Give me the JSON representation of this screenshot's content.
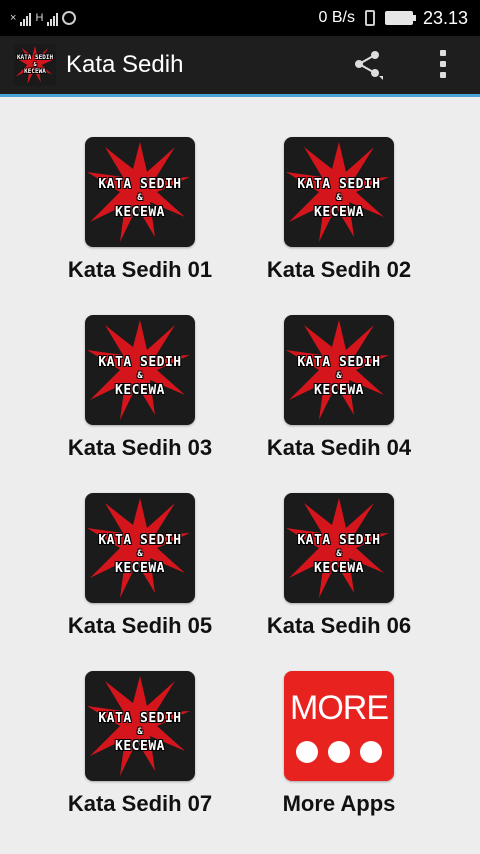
{
  "status_bar": {
    "net_type": "H",
    "data_speed": "0 B/s",
    "time": "23.13"
  },
  "action_bar": {
    "title": "Kata Sedih",
    "icon_text_line1": "KATA SEDIH",
    "icon_text_line2": "&",
    "icon_text_line3": "KECEWA"
  },
  "thumb_text": {
    "line1": "KATA SEDIH",
    "line2": "&",
    "line3": "KECEWA"
  },
  "items": [
    {
      "label": "Kata Sedih 01"
    },
    {
      "label": "Kata Sedih 02"
    },
    {
      "label": "Kata Sedih 03"
    },
    {
      "label": "Kata Sedih 04"
    },
    {
      "label": "Kata Sedih 05"
    },
    {
      "label": "Kata Sedih 06"
    },
    {
      "label": "Kata Sedih 07"
    }
  ],
  "more_apps": {
    "label": "More Apps",
    "icon_text": "MORE"
  },
  "colors": {
    "accent": "#4aa3d8",
    "more_red": "#e8221f",
    "splash_red": "#d4161c"
  }
}
